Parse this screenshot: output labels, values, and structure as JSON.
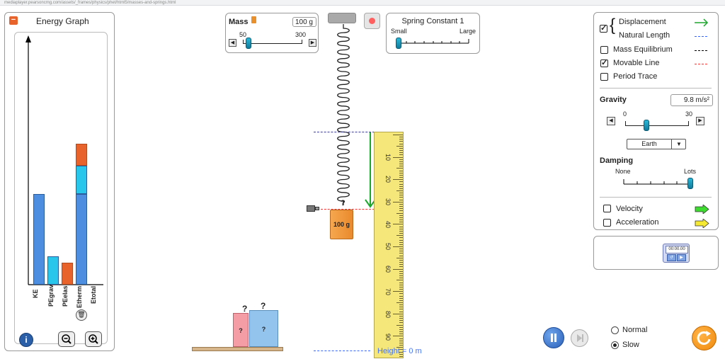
{
  "browser": {
    "url": "mediaplayer.pearsoncmg.com/assets/_frames/physics/phet/html5/masses-and-springs.html"
  },
  "energy_graph": {
    "title": "Energy Graph",
    "labels": [
      "KE",
      "PEgrav",
      "PEelas",
      "Etherm",
      "Etotal"
    ],
    "label_colors": [
      "#3db54a",
      "#3c86d8",
      "#29c6ec",
      "#e8632b",
      "#000000"
    ],
    "values": {
      "ke": 0,
      "pe_grav": 0.64,
      "pe_elas": 0.2,
      "e_therm": 0.155,
      "e_total": 1.0
    },
    "e_total_stack": [
      0.64,
      0.2,
      0.155
    ],
    "colors": {
      "pe_grav": "#4d8ee0",
      "pe_elas": "#29c6ec",
      "e_therm": "#e8632b"
    }
  },
  "mass": {
    "label": "Mass",
    "value": "100 g",
    "min": "50",
    "max": "300",
    "level": 0.1
  },
  "spring_constant": {
    "label": "Spring Constant 1",
    "min_label": "Small",
    "max_label": "Large",
    "level": 0.0
  },
  "hanging_mass": {
    "label": "100 g",
    "hook_label": "?"
  },
  "mystery_masses": [
    "?",
    "?"
  ],
  "mystery_mass_labels": [
    "?",
    "?"
  ],
  "ruler": {
    "numbers": [
      "10",
      "20",
      "30",
      "40",
      "50",
      "60",
      "70",
      "80",
      "90"
    ]
  },
  "height_label": "Height = 0 m",
  "right_panel": {
    "displacement": {
      "label": "Displacement",
      "checked": true
    },
    "natural_length": {
      "label": "Natural Length"
    },
    "mass_equilibrium": {
      "label": "Mass Equilibrium",
      "checked": false
    },
    "movable_line": {
      "label": "Movable Line",
      "checked": true
    },
    "period_trace": {
      "label": "Period Trace",
      "checked": false
    },
    "gravity": {
      "label": "Gravity",
      "value": "9.8 m/s²",
      "min": "0",
      "max": "30",
      "preset": "Earth",
      "level": 0.33
    },
    "damping": {
      "label": "Damping",
      "min_label": "None",
      "max_label": "Lots",
      "level": 1.0
    },
    "velocity": {
      "label": "Velocity",
      "checked": false
    },
    "acceleration": {
      "label": "Acceleration",
      "checked": false
    },
    "colors": {
      "displacement": "#1aa72b",
      "natural_length": "#3366ff",
      "mass_equilibrium": "#000000",
      "movable_line": "#ff2a2a",
      "velocity": "#3ddc2e",
      "acceleration": "#f5e932"
    }
  },
  "stopwatch": {
    "time": "00:00.00"
  },
  "speed": {
    "normal": "Normal",
    "slow": "Slow",
    "selected": "slow"
  },
  "icons": [
    "info-icon",
    "zoom-out-icon",
    "zoom-in-icon",
    "trash-icon",
    "pause-icon",
    "step-icon",
    "reset-icon",
    "stop-icon"
  ]
}
